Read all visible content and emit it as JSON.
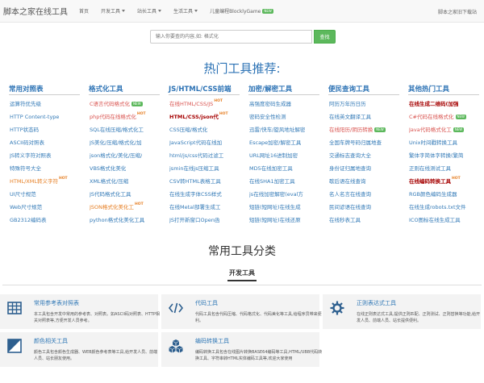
{
  "navbar": {
    "brand": "脚本之家在线工具",
    "items": [
      {
        "label": "首页",
        "dropdown": false
      },
      {
        "label": "开发工具",
        "dropdown": true
      },
      {
        "label": "站长工具",
        "dropdown": true
      },
      {
        "label": "生活工具",
        "dropdown": true
      },
      {
        "label": "儿童编程BlocklyGame",
        "dropdown": false,
        "badge": "NEW"
      }
    ],
    "right_link": "脚本之家旧下载站"
  },
  "search": {
    "placeholder": "输入你要查的内容,如: 格式化",
    "button_label": "查找"
  },
  "hot_section": {
    "title": "热门工具推荐:",
    "columns": [
      {
        "heading": "常用对照表",
        "items": [
          {
            "label": "运算符优先级",
            "style": "normal"
          },
          {
            "label": "HTTP Content-type",
            "style": "normal"
          },
          {
            "label": "HTTP状态码",
            "style": "normal"
          },
          {
            "label": "ASCII码对照表",
            "style": "normal"
          },
          {
            "label": "JS转义字符对照表",
            "style": "normal"
          },
          {
            "label": "特殊符号大全",
            "style": "normal"
          },
          {
            "label": "HTML/XML转义字符",
            "style": "orange",
            "badge": "HOT"
          },
          {
            "label": "UI尺寸规范",
            "style": "normal"
          },
          {
            "label": "Web尺寸规范",
            "style": "normal"
          },
          {
            "label": "GB2312编码表",
            "style": "normal"
          }
        ]
      },
      {
        "heading": "格式化工具",
        "items": [
          {
            "label": "C语言代码格式化",
            "style": "red",
            "badge": "NEW"
          },
          {
            "label": "php代码在线格式化",
            "style": "red",
            "badge": "HOT"
          },
          {
            "label": "SQL在线压缩/格式化工",
            "style": "normal"
          },
          {
            "label": "JS美化/压缩/格式化/加",
            "style": "normal"
          },
          {
            "label": "json格式化/美化/压缩/",
            "style": "normal"
          },
          {
            "label": "VBS格式化美化",
            "style": "normal"
          },
          {
            "label": "XML格式化/压缩",
            "style": "normal"
          },
          {
            "label": "JS代码格式化工具",
            "style": "normal"
          },
          {
            "label": "JSON格式化美化工",
            "style": "orange",
            "badge": "HOT"
          },
          {
            "label": "python格式化美化工具",
            "style": "normal"
          }
        ]
      },
      {
        "heading": "JS/HTML/CSS前端",
        "items": [
          {
            "label": "在线HTML/CSS/JS",
            "style": "red",
            "badge": "HOT"
          },
          {
            "label": "HTML/CSS/json代",
            "style": "dark",
            "badge": "HOT"
          },
          {
            "label": "CSS压缩/格式化",
            "style": "normal"
          },
          {
            "label": "JavaScript代码在线加",
            "style": "normal"
          },
          {
            "label": "html/js/css代码过滤工",
            "style": "normal"
          },
          {
            "label": "jsmin在线js压缩工具",
            "style": "normal"
          },
          {
            "label": "CSV转HTML表格工具",
            "style": "normal"
          },
          {
            "label": "在线生成字体CSS样式",
            "style": "normal"
          },
          {
            "label": "在线Metal部署生成工",
            "style": "normal"
          },
          {
            "label": "JS打开新窗口Open函",
            "style": "normal"
          }
        ]
      },
      {
        "heading": "加密/解密工具",
        "items": [
          {
            "label": "高强度密码生成器",
            "style": "normal"
          },
          {
            "label": "密码安全性检测",
            "style": "normal"
          },
          {
            "label": "迅雷/快车/旋风地址解密",
            "style": "normal"
          },
          {
            "label": "Escape加密/解密工具",
            "style": "normal"
          },
          {
            "label": "URL网址16进制加密",
            "style": "normal"
          },
          {
            "label": "MD5在线加密工具",
            "style": "normal"
          },
          {
            "label": "在线SHA1加密工具",
            "style": "normal"
          },
          {
            "label": "js在线加密解密(eval方",
            "style": "normal"
          },
          {
            "label": "短链(短网址)在线生成",
            "style": "normal"
          },
          {
            "label": "短链(短网址)在线还原",
            "style": "normal"
          }
        ]
      },
      {
        "heading": "便民查询工具",
        "items": [
          {
            "label": "阿历万年历日历",
            "style": "normal"
          },
          {
            "label": "在线英文翻译工具",
            "style": "normal"
          },
          {
            "label": "在线阳历/阴历转换",
            "style": "red",
            "badge": "NEW"
          },
          {
            "label": "全国车牌号码归属地查",
            "style": "normal"
          },
          {
            "label": "交通标志查询大全",
            "style": "normal"
          },
          {
            "label": "身份证归属地查询",
            "style": "normal"
          },
          {
            "label": "歇后语在线查询",
            "style": "normal"
          },
          {
            "label": "名人名言在线查询",
            "style": "normal"
          },
          {
            "label": "民间谚语在线查询",
            "style": "normal"
          },
          {
            "label": "在线秒表工具",
            "style": "normal"
          }
        ]
      },
      {
        "heading": "其他热门工具",
        "items": [
          {
            "label": "在线生成二维码(加强",
            "style": "dark"
          },
          {
            "label": "C#代码在线格式化",
            "style": "red",
            "badge": "NEW"
          },
          {
            "label": "Java代码格式化工",
            "style": "red",
            "badge": "NEW"
          },
          {
            "label": "Unix时间戳转换工具",
            "style": "normal"
          },
          {
            "label": "繁体字简体字转换(繁简",
            "style": "normal"
          },
          {
            "label": "正则在线测试工具",
            "style": "normal"
          },
          {
            "label": "在线编码转换工具",
            "style": "dark",
            "badge": "HOT"
          },
          {
            "label": "RGB颜色编码生成器",
            "style": "normal"
          },
          {
            "label": "在线生成robots.txt文件",
            "style": "normal"
          },
          {
            "label": "ICO图标在线生成工具",
            "style": "normal"
          }
        ]
      }
    ]
  },
  "common_section": {
    "title": "常用工具分类",
    "tabs": [
      "开发工具"
    ],
    "cards": [
      {
        "icon": "table-icon",
        "title": "常用参考表对照表",
        "desc": "本工具包含开发中常用的参考表、对照表。如ASCII码对照表、HTTP相关对照表等,方便开发人员参考。"
      },
      {
        "icon": "code-icon",
        "title": "代码工具",
        "desc": "代码工具包含代码压缩、代码格式化、代码美化等工具,给程序员带来便利。"
      },
      {
        "icon": "gear-icon",
        "title": "正则表达式工具",
        "desc": "在线正则表达式工具,提供正则匹配、正则测试、正则替换等功能,给开发人员、前端人员、站长提供便利。"
      },
      {
        "icon": "color-icon",
        "title": "颜色相关工具",
        "desc": "颜色工具包含颜色生成器、WEB颜色参考表等工具,给开发人员、前端人员、站长朋友使用。"
      },
      {
        "icon": "cubes-icon",
        "title": "编码转换工具",
        "desc": "编码转换工具包含在线图片转换BASE64编码等工具,HTML/UBB代码转换工具、字符串转HTML实体编码工具等,欢迎大家使用"
      }
    ]
  },
  "colors": {
    "accent": "#2d73b5",
    "link": "#337ab7",
    "hot_red": "#d9534f",
    "dark_red": "#a50000",
    "new_green": "#5cb85c"
  }
}
